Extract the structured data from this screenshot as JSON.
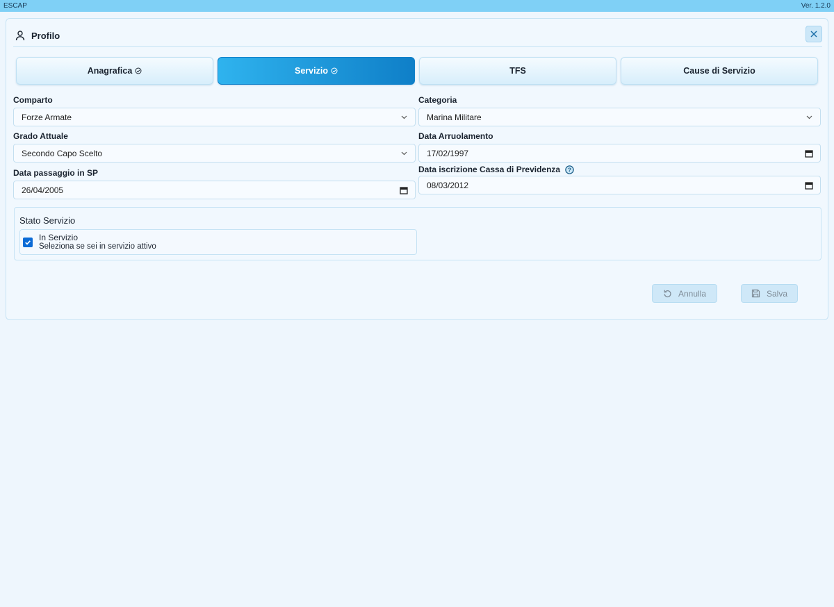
{
  "window": {
    "app_title": "ESCAP",
    "version": "Ver. 1.2.0"
  },
  "panel": {
    "title": "Profilo",
    "icon": "user-icon",
    "close_icon": "close-icon"
  },
  "tabs": [
    {
      "label": "Anagrafica",
      "completed": true,
      "active": false
    },
    {
      "label": "Servizio",
      "completed": true,
      "active": true
    },
    {
      "label": "TFS",
      "completed": false,
      "active": false
    },
    {
      "label": "Cause di Servizio",
      "completed": false,
      "active": false
    }
  ],
  "form": {
    "comparto": {
      "label": "Comparto",
      "value": "Forze Armate"
    },
    "categoria": {
      "label": "Categoria",
      "value": "Marina Militare"
    },
    "grado_attuale": {
      "label": "Grado Attuale",
      "value": "Secondo Capo Scelto"
    },
    "data_arruolamento": {
      "label": "Data Arruolamento",
      "value": "17/02/1997"
    },
    "data_passaggio_sp": {
      "label": "Data passaggio in SP",
      "value": "26/04/2005"
    },
    "data_iscrizione_cassa": {
      "label": "Data iscrizione Cassa di Previdenza",
      "value": "08/03/2012",
      "help_icon": "help-icon"
    }
  },
  "stato_servizio": {
    "title": "Stato Servizio",
    "checkbox": {
      "label": "In Servizio",
      "description": "Seleziona se sei in servizio attivo",
      "checked": true
    }
  },
  "actions": {
    "cancel_label": "Annulla",
    "save_label": "Salva",
    "disabled": true
  },
  "colors": {
    "titlebar": "#7fd0f6",
    "accent": "#0f7fc8",
    "accent_light": "#2fb3ee",
    "checkbox": "#0c6bd6",
    "background": "#eef6fd"
  }
}
